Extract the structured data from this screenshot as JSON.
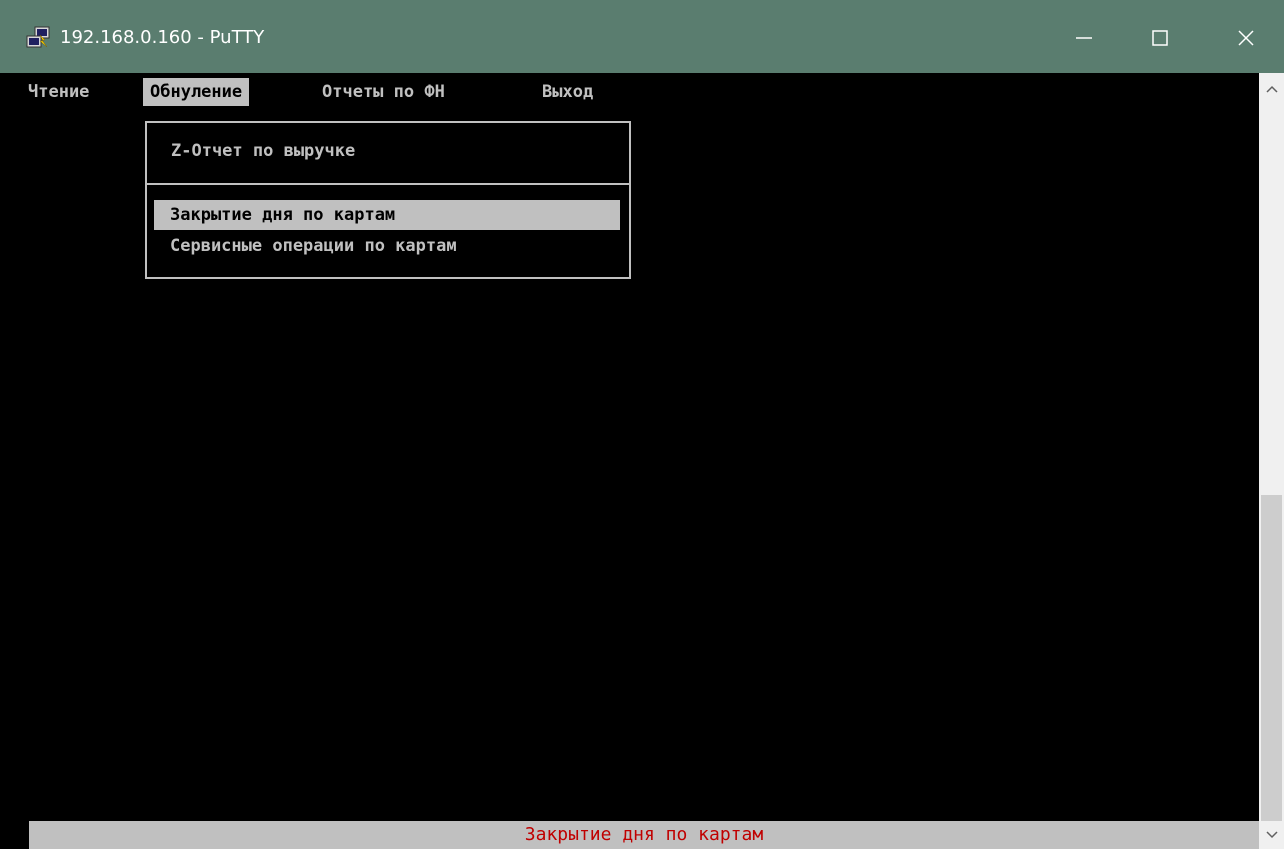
{
  "window": {
    "title": "192.168.0.160 - PuTTY",
    "colors": {
      "titlebar": "#5a7d6f",
      "terminal_bg": "#000000",
      "menu_fg": "#c0c0c0",
      "highlight_bg": "#c0c0c0",
      "status_fg": "#c00000"
    },
    "icons": {
      "app": "putty-icon",
      "minimize": "minimize-icon",
      "maximize": "maximize-icon",
      "close": "close-icon"
    }
  },
  "menubar": {
    "items": [
      {
        "label": "Чтение"
      },
      {
        "label": "Обнуление"
      },
      {
        "label": "Отчеты по ФН"
      },
      {
        "label": "Выход"
      }
    ],
    "active_index": 1
  },
  "dropdown": {
    "header": "Z-Отчет по выручке",
    "items": [
      {
        "label": "Закрытие дня по картам"
      },
      {
        "label": "Сервисные операции по картам"
      }
    ],
    "selected_index": 0
  },
  "statusbar": {
    "text": "Закрытие дня по картам"
  },
  "scrollbar": {
    "icons": {
      "up": "scroll-up-arrow-icon",
      "down": "scroll-down-arrow-icon"
    }
  }
}
